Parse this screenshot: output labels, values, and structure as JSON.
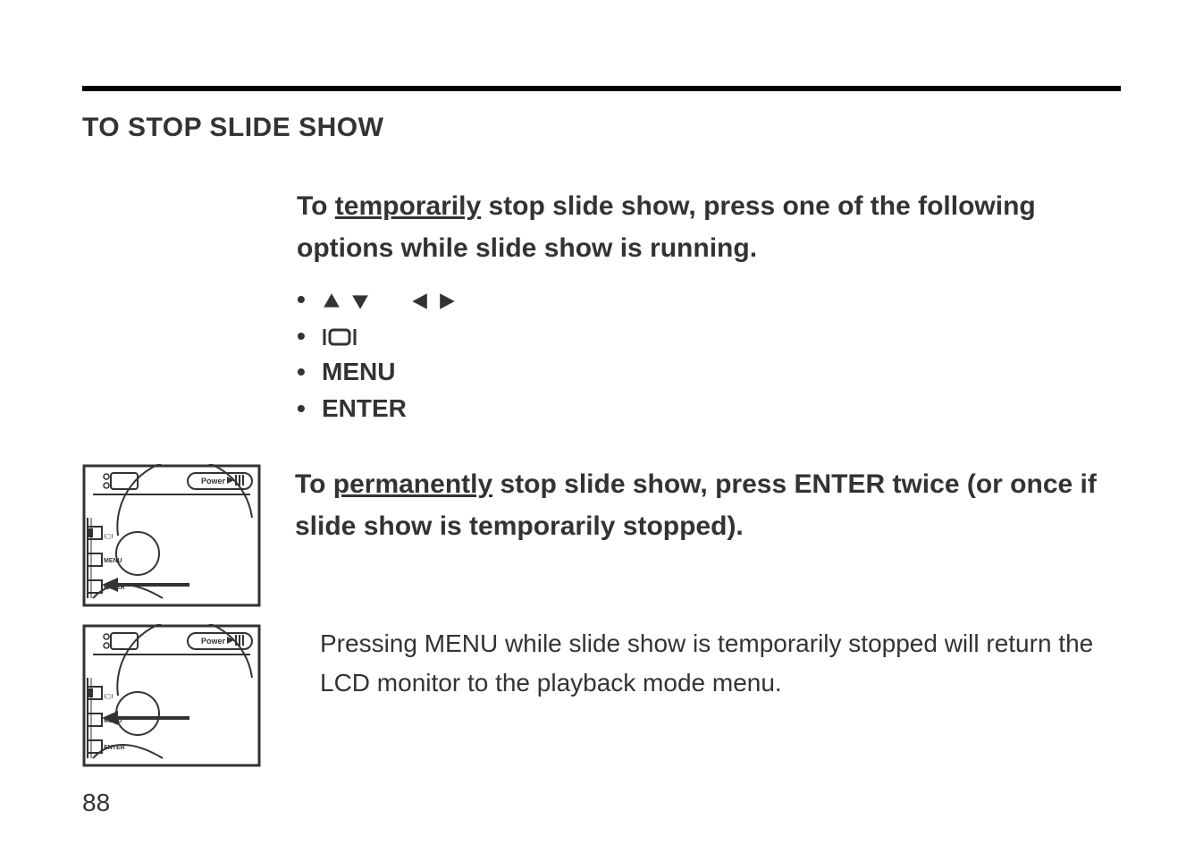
{
  "section_heading": "TO STOP SLIDE SHOW",
  "temp_stop": {
    "prefix": "To ",
    "underlined": "temporarily",
    "suffix": " stop slide show, press one of the following options while slide show is running."
  },
  "bullets": {
    "menu": "MENU",
    "enter": "ENTER"
  },
  "perm_stop": {
    "prefix": "To ",
    "underlined": "permanently",
    "suffix": " stop slide show, press ENTER twice (or once if slide show is temporarily stopped)."
  },
  "note": "Pressing MENU while slide show is temporarily stopped will return the LCD monitor to the playback mode menu.",
  "page_number": "88",
  "figure_labels": {
    "power": "Power",
    "menu": "MENU",
    "enter": "ENTER"
  }
}
